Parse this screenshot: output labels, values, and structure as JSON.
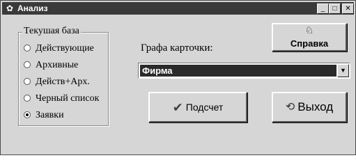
{
  "window": {
    "title": "Анализ",
    "icons": {
      "app": "app-icon",
      "minimize": "minimize-icon",
      "maximize": "maximize-icon",
      "close": "close-icon"
    }
  },
  "base_group": {
    "title": "Текушая база",
    "options": [
      {
        "label": "Действующие",
        "selected": false
      },
      {
        "label": "Архивные",
        "selected": false
      },
      {
        "label": "Действ+Арх.",
        "selected": false
      },
      {
        "label": "Черный список",
        "selected": false
      },
      {
        "label": "Заявки",
        "selected": true
      }
    ]
  },
  "field": {
    "label": "Графа карточки:",
    "selected_value": "Фирма"
  },
  "buttons": {
    "help": {
      "label": "Справка",
      "icon": "help-bell-icon"
    },
    "count": {
      "label": "Подсчет",
      "icon": "checkmark-icon"
    },
    "exit": {
      "label": "Выход",
      "icon": "exit-arrow-icon"
    }
  }
}
